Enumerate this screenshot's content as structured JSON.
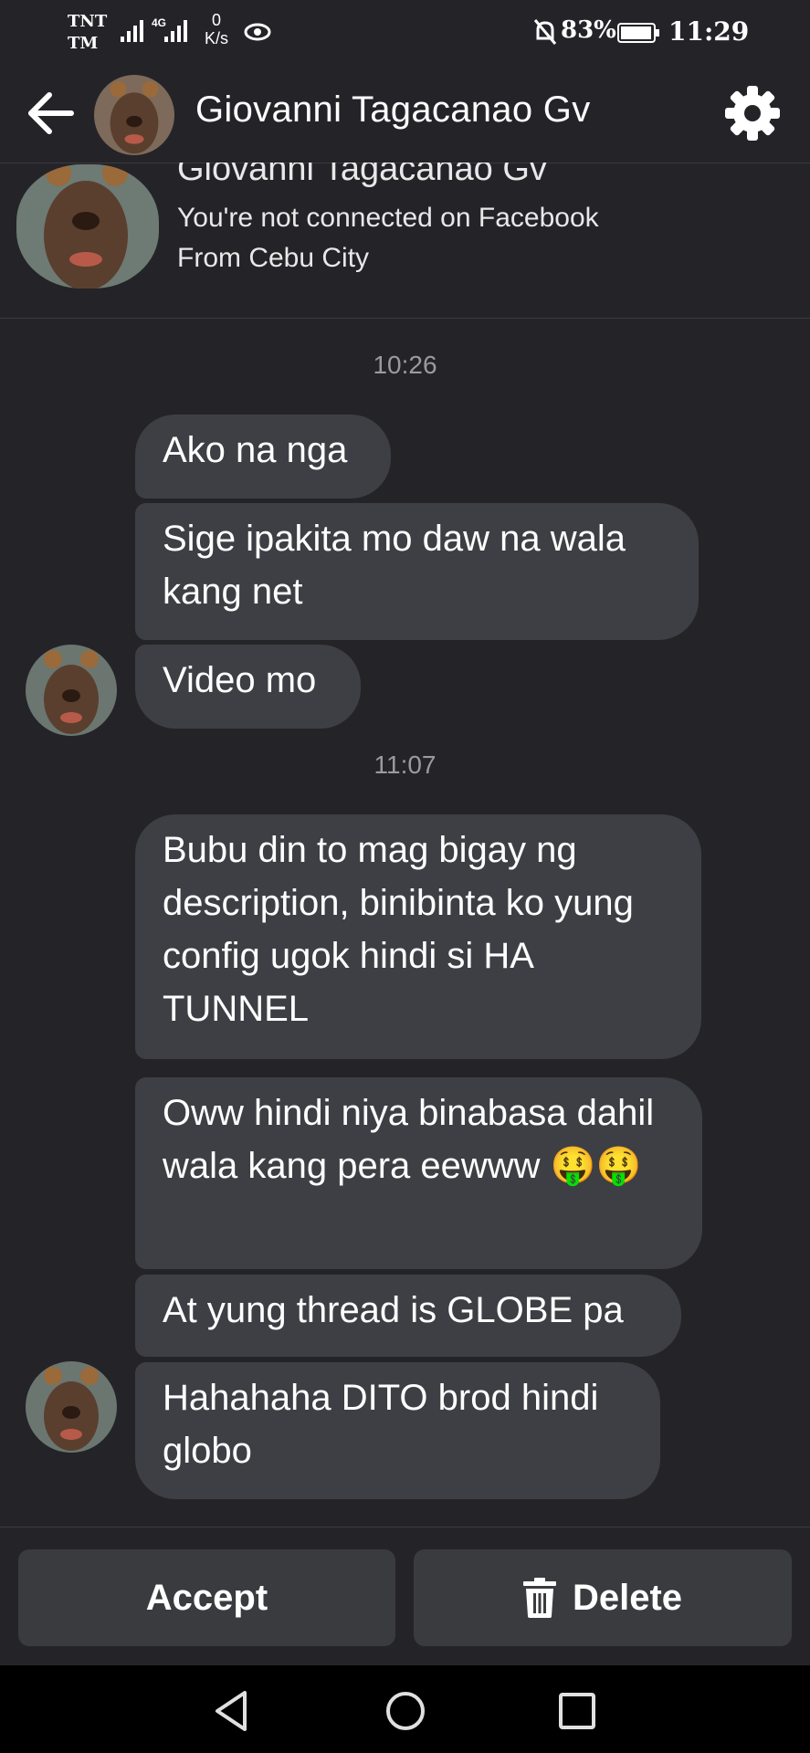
{
  "status_bar": {
    "carrier_line1": "TNT",
    "carrier_line2": "TM",
    "network_type": "4G",
    "speed_value": "0",
    "speed_unit": "K/s",
    "battery": "83%",
    "time": "11:29",
    "icons": [
      "signal-icon",
      "eye-icon",
      "mute-icon",
      "battery-icon"
    ]
  },
  "header": {
    "title": "Giovanni Tagacanao Gv",
    "back_icon": "arrow-left-icon",
    "settings_icon": "gear-icon"
  },
  "profile": {
    "name": "Giovanni Tagacanao Gv",
    "line1": "You're not connected on Facebook",
    "line2": "From Cebu City"
  },
  "conversation": {
    "groups": [
      {
        "time": "10:26",
        "messages": [
          "Ako na nga",
          "Sige ipakita mo daw na wala kang net",
          "Video mo"
        ]
      },
      {
        "time": "11:07",
        "messages": [
          "Bubu din to mag bigay ng description, binibinta ko yung config ugok hindi si HA TUNNEL",
          "Oww hindi niya binabasa dahil wala kang pera eewww 🤑🤑",
          "At yung thread is GLOBE pa",
          "Hahahaha DITO brod hindi globo"
        ]
      }
    ]
  },
  "actions": {
    "accept_label": "Accept",
    "delete_label": "Delete"
  },
  "colors": {
    "background": "#242428",
    "bubble": "#3e3f44",
    "button": "#3a3b3f",
    "muted_text": "#9a9b9f"
  }
}
